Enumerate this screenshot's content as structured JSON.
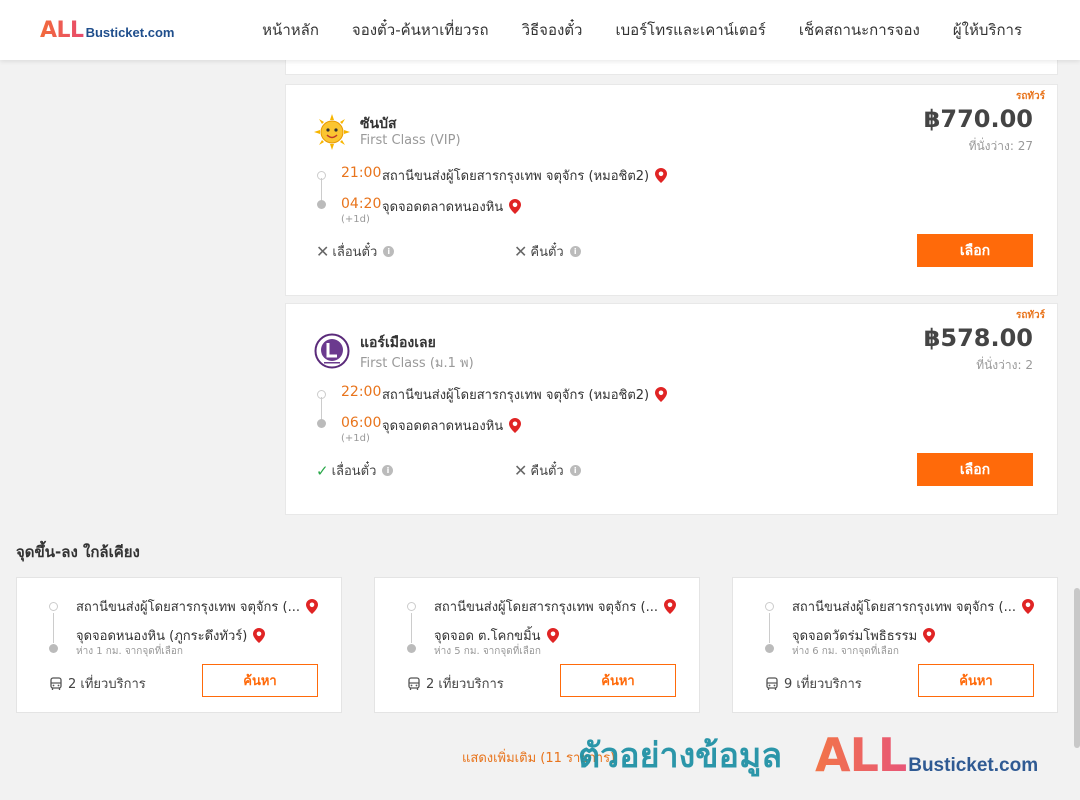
{
  "header": {
    "logo_all": "ALL",
    "logo_busticket": "Busticket.com",
    "nav": [
      {
        "label": "หน้าหลัก"
      },
      {
        "label": "จองตั๋ว-ค้นหาเที่ยวรถ"
      },
      {
        "label": "วิธีจองตั๋ว"
      },
      {
        "label": "เบอร์โทรและเคาน์เตอร์"
      },
      {
        "label": "เช็คสถานะการจอง"
      },
      {
        "label": "ผู้ให้บริการ"
      }
    ]
  },
  "results": [
    {
      "tag": "รถทัวร์",
      "operator": "ซันบัส",
      "bus_class": "First Class (VIP)",
      "price": "฿770.00",
      "seats": "ที่นั่งว่าง: 27",
      "depart_time": "21:00",
      "depart_place": "สถานีขนส่งผู้โดยสารกรุงเทพ จตุจักร (หมอชิต2)",
      "arrive_time": "04:20",
      "arrive_place": "จุดจอดตลาดหนองหิน",
      "day_offset": "(+1d)",
      "reschedule_label": "เลื่อนตั๋ว",
      "reschedule_allowed": false,
      "refund_label": "คืนตั๋ว",
      "refund_allowed": false,
      "select_label": "เลือก",
      "logo_icon": "sun-mascot-icon"
    },
    {
      "tag": "รถทัวร์",
      "operator": "แอร์เมืองเลย",
      "bus_class": "First Class (ม.1 พ)",
      "price": "฿578.00",
      "seats": "ที่นั่งว่าง: 2",
      "depart_time": "22:00",
      "depart_place": "สถานีขนส่งผู้โดยสารกรุงเทพ จตุจักร (หมอชิต2)",
      "arrive_time": "06:00",
      "arrive_place": "จุดจอดตลาดหนองหิน",
      "day_offset": "(+1d)",
      "reschedule_label": "เลื่อนตั๋ว",
      "reschedule_allowed": true,
      "refund_label": "คืนตั๋ว",
      "refund_allowed": false,
      "select_label": "เลือก",
      "logo_icon": "letter-l-circle-icon"
    }
  ],
  "nearby": {
    "title": "จุดขึ้น-ลง ใกล้เคียง",
    "items": [
      {
        "from": "สถานีขนส่งผู้โดยสารกรุงเทพ จตุจักร (...",
        "to": "จุดจอดหนองหิน (ภูกระดึงทัวร์)",
        "distance": "ห่าง 1 กม. จากจุดที่เลือก",
        "trips": "2 เที่ยวบริการ",
        "search_label": "ค้นหา"
      },
      {
        "from": "สถานีขนส่งผู้โดยสารกรุงเทพ จตุจักร (...",
        "to": "จุดจอด ต.โคกขมิ้น",
        "distance": "ห่าง 5 กม. จากจุดที่เลือก",
        "trips": "2 เที่ยวบริการ",
        "search_label": "ค้นหา"
      },
      {
        "from": "สถานีขนส่งผู้โดยสารกรุงเทพ จตุจักร (...",
        "to": "จุดจอดวัดร่มโพธิธรรม",
        "distance": "ห่าง 6 กม. จากจุดที่เลือก",
        "trips": "9 เที่ยวบริการ",
        "search_label": "ค้นหา"
      }
    ]
  },
  "show_more": "แสดงเพิ่มเติม (11 รายการ)",
  "watermark": {
    "text": "ตัวอย่างข้อมูล",
    "logo_all": "ALL",
    "logo_busticket": "Busticket.com"
  },
  "colors": {
    "accent": "#ff6a0a",
    "time": "#e8741c",
    "pin": "#e02424",
    "check": "#2aa84a"
  }
}
